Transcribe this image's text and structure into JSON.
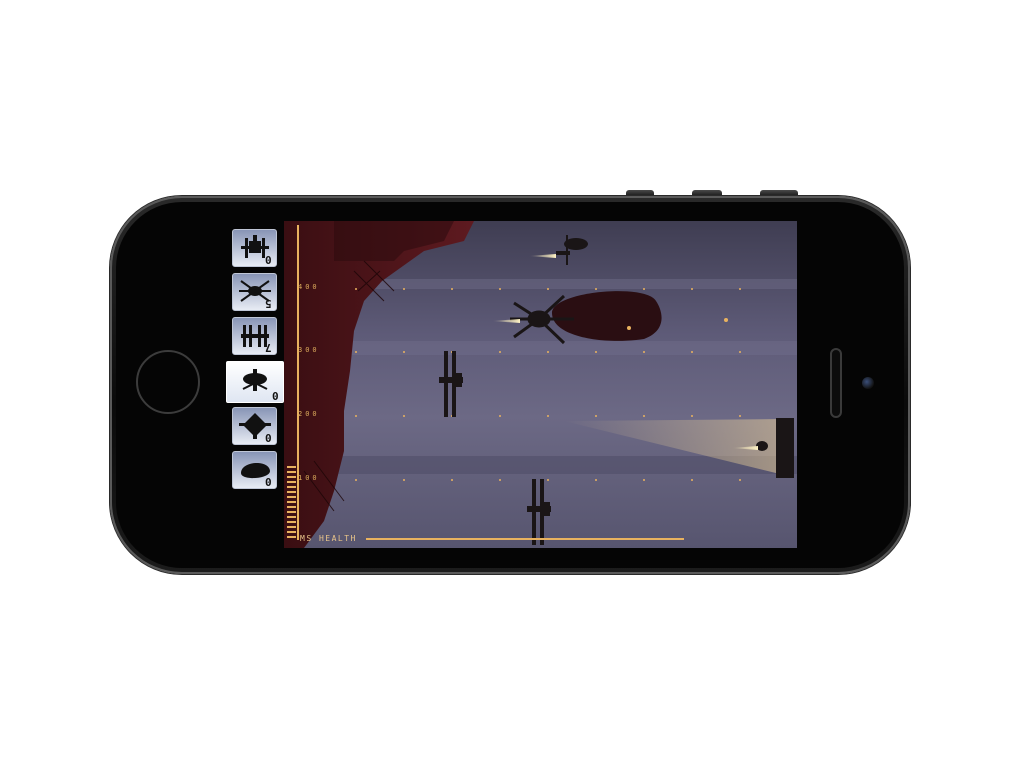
{
  "hud": {
    "altitude_labels": [
      "400",
      "300",
      "200",
      "100"
    ],
    "health_label": "MS HEALTH",
    "menu_icon": "hamburger-menu-icon",
    "accent_color": "#e8b25f",
    "indicator_color": "#4fe3da"
  },
  "units": [
    {
      "name": "heavy-bomber",
      "count": "0"
    },
    {
      "name": "spider-gunship",
      "count": "5"
    },
    {
      "name": "biplane-squadron",
      "count": "7"
    },
    {
      "name": "saucer-fighter",
      "count": "0"
    },
    {
      "name": "winged-lander",
      "count": "0"
    },
    {
      "name": "zeppelin",
      "count": "0"
    }
  ],
  "selected_unit_index": 3
}
